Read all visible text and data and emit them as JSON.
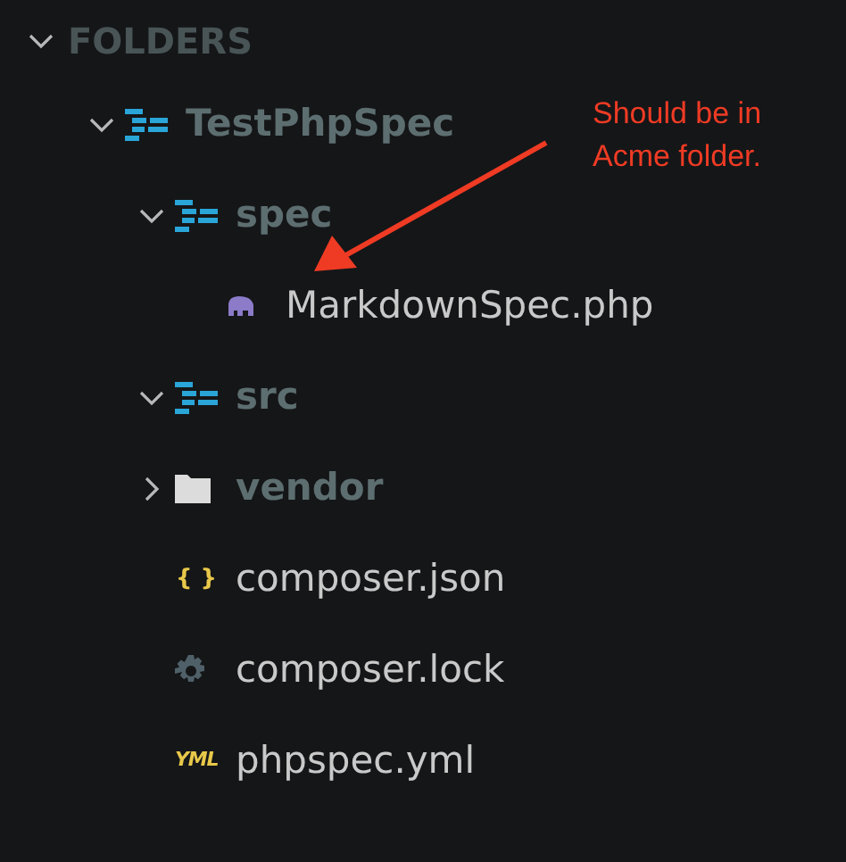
{
  "header": {
    "label": "FOLDERS",
    "expanded": true
  },
  "tree": [
    {
      "kind": "project",
      "label": "TestPhpSpec",
      "expanded": true,
      "children": [
        {
          "kind": "project",
          "label": "spec",
          "expanded": true,
          "children": [
            {
              "kind": "php",
              "label": "MarkdownSpec.php"
            }
          ]
        },
        {
          "kind": "project",
          "label": "src",
          "expanded": true
        },
        {
          "kind": "folder",
          "label": "vendor",
          "expanded": false
        },
        {
          "kind": "json",
          "label": "composer.json",
          "icon_text": "{ }"
        },
        {
          "kind": "lock",
          "label": "composer.lock"
        },
        {
          "kind": "yaml",
          "label": "phpspec.yml",
          "icon_text": "YML"
        }
      ]
    }
  ],
  "annotation": {
    "lines": [
      "Should be in",
      "Acme folder."
    ]
  }
}
